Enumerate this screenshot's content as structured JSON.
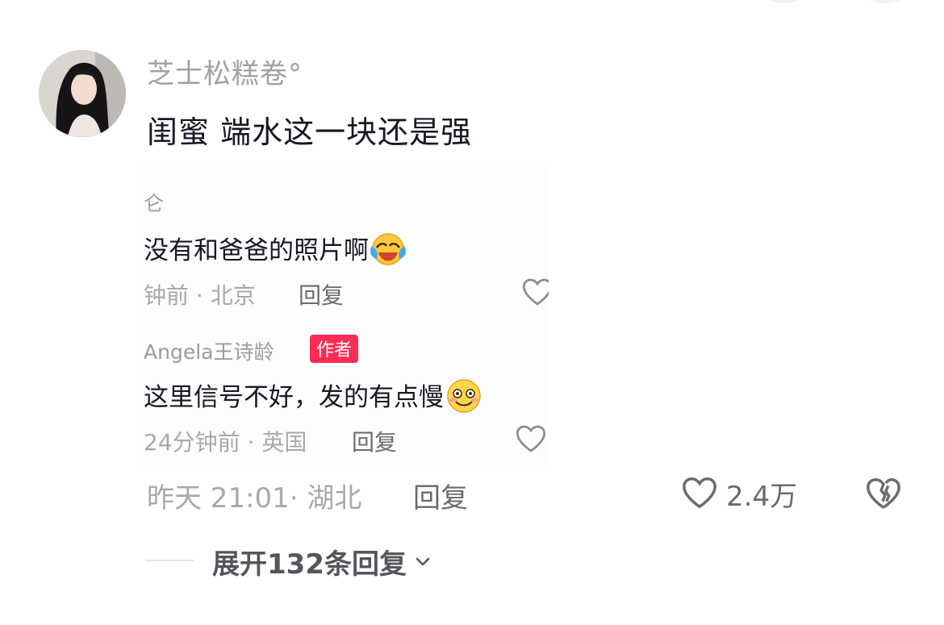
{
  "comment": {
    "username": "芝士松糕卷°",
    "text": "闺蜜 端水这一块还是强",
    "time_location": "昨天 21:01· 湖北",
    "reply_label": "回复",
    "like_count": "2.4万",
    "expand_label": "展开132条回复"
  },
  "embedded_screenshot": {
    "reply1": {
      "username": "仑",
      "text": "没有和爸爸的照片啊",
      "emoji": "laughing-crying-emoji",
      "time_location": "钟前 · 北京",
      "reply_label": "回复"
    },
    "reply2": {
      "username": "Angela王诗龄",
      "badge": "作者",
      "text": "这里信号不好，发的有点慢",
      "emoji": "smiling-emoji",
      "time_location": "24分钟前 · 英国",
      "reply_label": "回复"
    }
  },
  "colors": {
    "accent": "#fe2c55",
    "text_primary": "#161823",
    "text_secondary": "#a8a8ad"
  },
  "icons": [
    "heart-outline-icon",
    "broken-heart-icon",
    "chevron-down-icon"
  ]
}
